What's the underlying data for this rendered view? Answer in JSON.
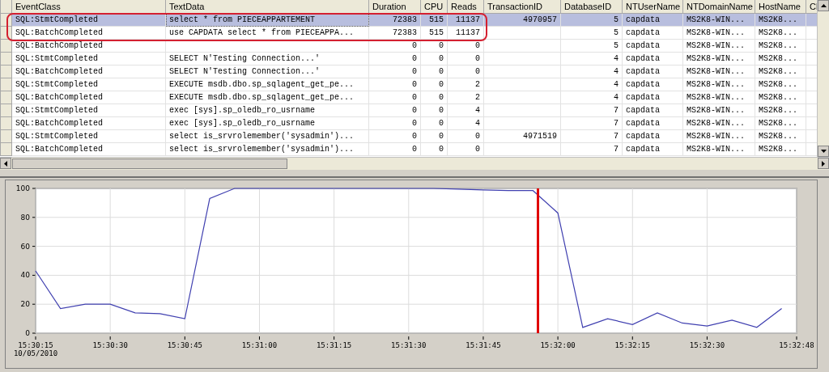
{
  "table": {
    "columns": [
      "EventClass",
      "TextData",
      "Duration",
      "CPU",
      "Reads",
      "TransactionID",
      "DatabaseID",
      "NTUserName",
      "NTDomainName",
      "HostName",
      "Cl"
    ],
    "rows": [
      {
        "selected": true,
        "circled": true,
        "cells": [
          "SQL:StmtCompleted",
          "select * from PIECEAPPARTEMENT",
          "72383",
          "515",
          "11137",
          "4970957",
          "5",
          "capdata",
          "MS2K8-WIN...",
          "MS2K8...",
          ""
        ]
      },
      {
        "selected": false,
        "circled": true,
        "cells": [
          "SQL:BatchCompleted",
          "use CAPDATA select * from PIECEAPPA...",
          "72383",
          "515",
          "11137",
          "",
          "5",
          "capdata",
          "MS2K8-WIN...",
          "MS2K8...",
          ""
        ]
      },
      {
        "selected": false,
        "circled": false,
        "cells": [
          "SQL:BatchCompleted",
          "",
          "0",
          "0",
          "0",
          "",
          "5",
          "capdata",
          "MS2K8-WIN...",
          "MS2K8...",
          ""
        ]
      },
      {
        "selected": false,
        "circled": false,
        "cells": [
          "SQL:StmtCompleted",
          "SELECT N'Testing Connection...'",
          "0",
          "0",
          "0",
          "",
          "4",
          "capdata",
          "MS2K8-WIN...",
          "MS2K8...",
          ""
        ]
      },
      {
        "selected": false,
        "circled": false,
        "cells": [
          "SQL:BatchCompleted",
          "SELECT N'Testing Connection...'",
          "0",
          "0",
          "0",
          "",
          "4",
          "capdata",
          "MS2K8-WIN...",
          "MS2K8...",
          ""
        ]
      },
      {
        "selected": false,
        "circled": false,
        "cells": [
          "SQL:StmtCompleted",
          "EXECUTE msdb.dbo.sp_sqlagent_get_pe...",
          "0",
          "0",
          "2",
          "",
          "4",
          "capdata",
          "MS2K8-WIN...",
          "MS2K8...",
          ""
        ]
      },
      {
        "selected": false,
        "circled": false,
        "cells": [
          "SQL:BatchCompleted",
          "EXECUTE msdb.dbo.sp_sqlagent_get_pe...",
          "0",
          "0",
          "2",
          "",
          "4",
          "capdata",
          "MS2K8-WIN...",
          "MS2K8...",
          ""
        ]
      },
      {
        "selected": false,
        "circled": false,
        "cells": [
          "SQL:StmtCompleted",
          "exec [sys].sp_oledb_ro_usrname",
          "0",
          "0",
          "4",
          "",
          "7",
          "capdata",
          "MS2K8-WIN...",
          "MS2K8...",
          ""
        ]
      },
      {
        "selected": false,
        "circled": false,
        "cells": [
          "SQL:BatchCompleted",
          "exec [sys].sp_oledb_ro_usrname",
          "0",
          "0",
          "4",
          "",
          "7",
          "capdata",
          "MS2K8-WIN...",
          "MS2K8...",
          ""
        ]
      },
      {
        "selected": false,
        "circled": false,
        "cells": [
          "SQL:StmtCompleted",
          "select is_srvrolemember('sysadmin')...",
          "0",
          "0",
          "0",
          "4971519",
          "7",
          "capdata",
          "MS2K8-WIN...",
          "MS2K8...",
          ""
        ]
      },
      {
        "selected": false,
        "circled": false,
        "cells": [
          "SQL:BatchCompleted",
          "select is_srvrolemember('sysadmin')...",
          "0",
          "0",
          "0",
          "",
          "7",
          "capdata",
          "MS2K8-WIN...",
          "MS2K8...",
          ""
        ]
      }
    ]
  },
  "chart": {
    "date_label": "10/05/2010",
    "chart_data": {
      "type": "line",
      "x": [
        55815,
        55820,
        55825,
        55830,
        55835,
        55840,
        55845,
        55850,
        55855,
        55860,
        55865,
        55870,
        55875,
        55880,
        55885,
        55890,
        55895,
        55900,
        55905,
        55910,
        55915,
        55920,
        55925,
        55930,
        55935,
        55940,
        55945,
        55950,
        55955,
        55960,
        55965
      ],
      "series": [
        {
          "color": "#4040b0",
          "values": [
            43,
            17,
            20,
            20,
            14,
            13.5,
            10,
            93,
            100,
            100,
            100,
            100,
            100,
            100,
            100,
            100,
            100,
            99.5,
            99,
            98.5,
            98.5,
            83,
            4,
            10,
            6,
            14,
            7,
            5,
            9,
            4,
            17
          ]
        }
      ],
      "xlim": [
        55815,
        55968
      ],
      "ylim": [
        0,
        100
      ],
      "xticks": [
        {
          "value": 55815,
          "label": "15:30:15"
        },
        {
          "value": 55830,
          "label": "15:30:30"
        },
        {
          "value": 55845,
          "label": "15:30:45"
        },
        {
          "value": 55860,
          "label": "15:31:00"
        },
        {
          "value": 55875,
          "label": "15:31:15"
        },
        {
          "value": 55890,
          "label": "15:31:30"
        },
        {
          "value": 55905,
          "label": "15:31:45"
        },
        {
          "value": 55920,
          "label": "15:32:00"
        },
        {
          "value": 55935,
          "label": "15:32:15"
        },
        {
          "value": 55950,
          "label": "15:32:30"
        },
        {
          "value": 55968,
          "label": "15:32:48"
        }
      ],
      "yticks": [
        0,
        20,
        40,
        60,
        80,
        100
      ],
      "grid": true,
      "ref_lines": [
        {
          "axis": "x",
          "value": 55916
        }
      ]
    }
  }
}
